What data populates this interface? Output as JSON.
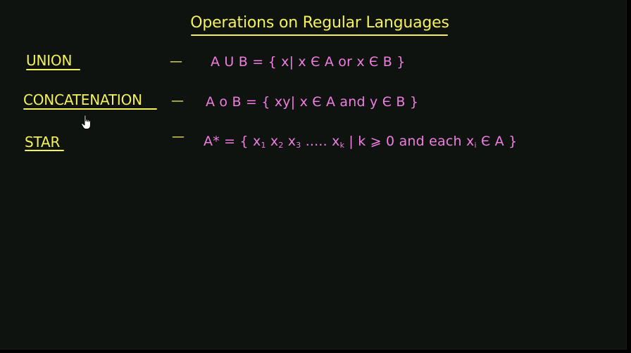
{
  "title": "Operations on Regular Languages",
  "rows": [
    {
      "term": "UNION",
      "dash": "—",
      "definition": "A U B = { x| x Є A or x Є B }"
    },
    {
      "term": "CONCATENATION",
      "dash": "—",
      "definition": "A o B = { xy| x Є A and y Є B }"
    },
    {
      "term": "STAR",
      "dash": "—",
      "definition_parts": {
        "lead": "A* = { x",
        "s1": "1",
        "mid1": " x",
        "s2": "2",
        "mid2": " x",
        "s3": "3",
        "mid3": " ..... x",
        "sk": "k",
        "mid4": " | k ⩾ 0 and each x",
        "si": "i",
        "tail": " Є A }"
      }
    }
  ],
  "colors": {
    "background": "#0f130f",
    "heading": "#f4f15b",
    "definition": "#ef7ee0"
  },
  "icons": {
    "cursor": "hand-pointer-icon"
  }
}
